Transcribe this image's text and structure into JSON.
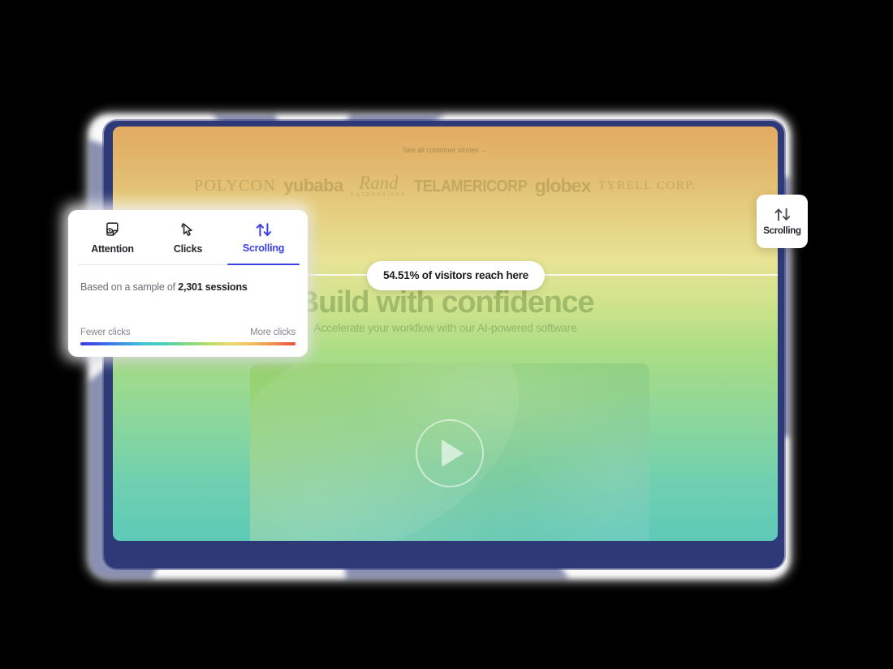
{
  "panel": {
    "tabs": [
      {
        "label": "Attention",
        "icon": "attention-eye-icon",
        "active": false
      },
      {
        "label": "Clicks",
        "icon": "cursor-click-icon",
        "active": false
      },
      {
        "label": "Scrolling",
        "icon": "scroll-updown-arrows-icon",
        "active": true
      }
    ],
    "sample_prefix": "Based on a sample of ",
    "sample_value": "2,301 sessions",
    "legend": {
      "low_label": "Fewer clicks",
      "high_label": "More clicks",
      "gradient_stops": [
        "#3b3ce0",
        "#3fc2d8",
        "#86d87e",
        "#ead96a",
        "#ef8b50",
        "#e8513f"
      ]
    },
    "accent_color": "#3b40e3"
  },
  "mode_badge": {
    "label": "Scrolling",
    "icon": "scroll-updown-arrows-icon"
  },
  "depth_tooltip": {
    "text": "54.51% of visitors reach here",
    "percent": 54.51
  },
  "page": {
    "stories_link": "See all customer stories →",
    "logos": [
      {
        "name": "POLYCON"
      },
      {
        "name": "yubaba"
      },
      {
        "name": "Rand",
        "sub": "ENTERPRISES"
      },
      {
        "name": "TELAMERICORP"
      },
      {
        "name": "globex"
      },
      {
        "name": "TYRELL CORP."
      }
    ],
    "headline": "Build with confidence",
    "subhead": "Accelerate your workflow with our AI-powered software",
    "video": {
      "play_icon": "play-triangle-icon"
    },
    "colors": {
      "gradient_top": "#e3ab62",
      "gradient_mid": "#a8dd85",
      "gradient_bottom": "#5ec9b7",
      "frame": "#2e3a78"
    }
  }
}
